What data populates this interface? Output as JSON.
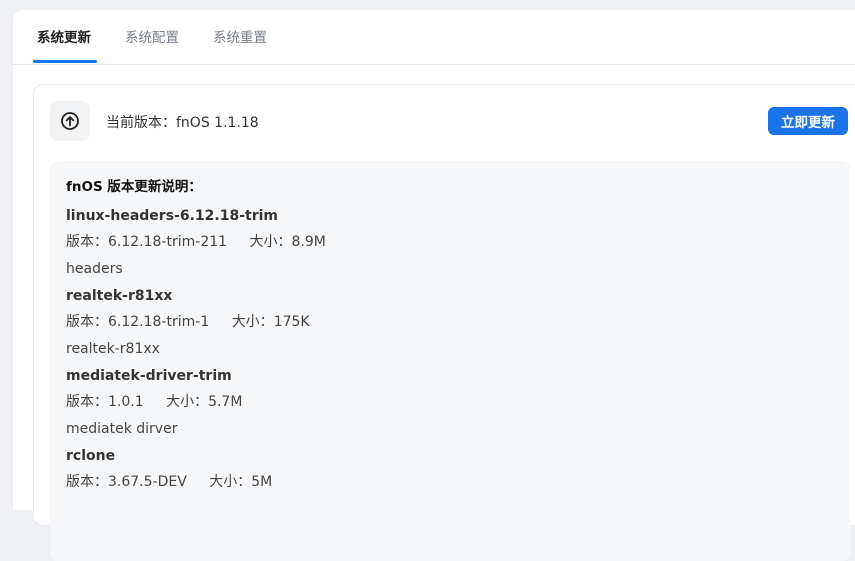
{
  "tabs": [
    {
      "label": "系统更新",
      "active": true
    },
    {
      "label": "系统配置",
      "active": false
    },
    {
      "label": "系统重置",
      "active": false
    }
  ],
  "current_version": {
    "label": "当前版本：",
    "value": "fnOS 1.1.18"
  },
  "update_button": "立即更新",
  "notes_title": "fnOS 版本更新说明：",
  "version_label": "版本：",
  "size_label": "大小：",
  "packages": [
    {
      "name": "linux-headers-6.12.18-trim",
      "version": "6.12.18-trim-211",
      "size": "8.9M",
      "description": "headers"
    },
    {
      "name": "realtek-r81xx",
      "version": "6.12.18-trim-1",
      "size": "175K",
      "description": "realtek-r81xx"
    },
    {
      "name": "mediatek-driver-trim",
      "version": "1.0.1",
      "size": "5.7M",
      "description": "mediatek dirver"
    },
    {
      "name": "rclone",
      "version": "3.67.5-DEV",
      "size": "5M",
      "description": ""
    }
  ],
  "colors": {
    "accent": "#1a73e8",
    "background": "#eef0f3",
    "notes_bg": "#f6f7f9"
  },
  "icons": {
    "update": "arrow-up-circle-icon"
  }
}
